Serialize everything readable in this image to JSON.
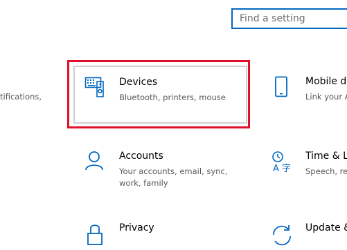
{
  "search": {
    "placeholder": "Find a setting"
  },
  "left_partial": {
    "text": "tifications,"
  },
  "tiles": {
    "devices": {
      "title": "Devices",
      "desc": "Bluetooth, printers, mouse",
      "icon": "keyboard-speaker-icon"
    },
    "mobile": {
      "title": "Mobile de",
      "desc": "Link your A",
      "icon": "phone-icon"
    },
    "accounts": {
      "title": "Accounts",
      "desc": "Your accounts, email, sync, work, family",
      "icon": "person-icon"
    },
    "time": {
      "title": "Time & La",
      "desc": "Speech, reg",
      "icon": "time-language-icon"
    },
    "privacy": {
      "title": "Privacy",
      "icon": "lock-icon"
    },
    "update": {
      "title": "Update &",
      "icon": "sync-arrows-icon"
    }
  },
  "colors": {
    "accent": "#0067c0",
    "highlight": "#e0102a",
    "secondary_text": "#595959"
  }
}
